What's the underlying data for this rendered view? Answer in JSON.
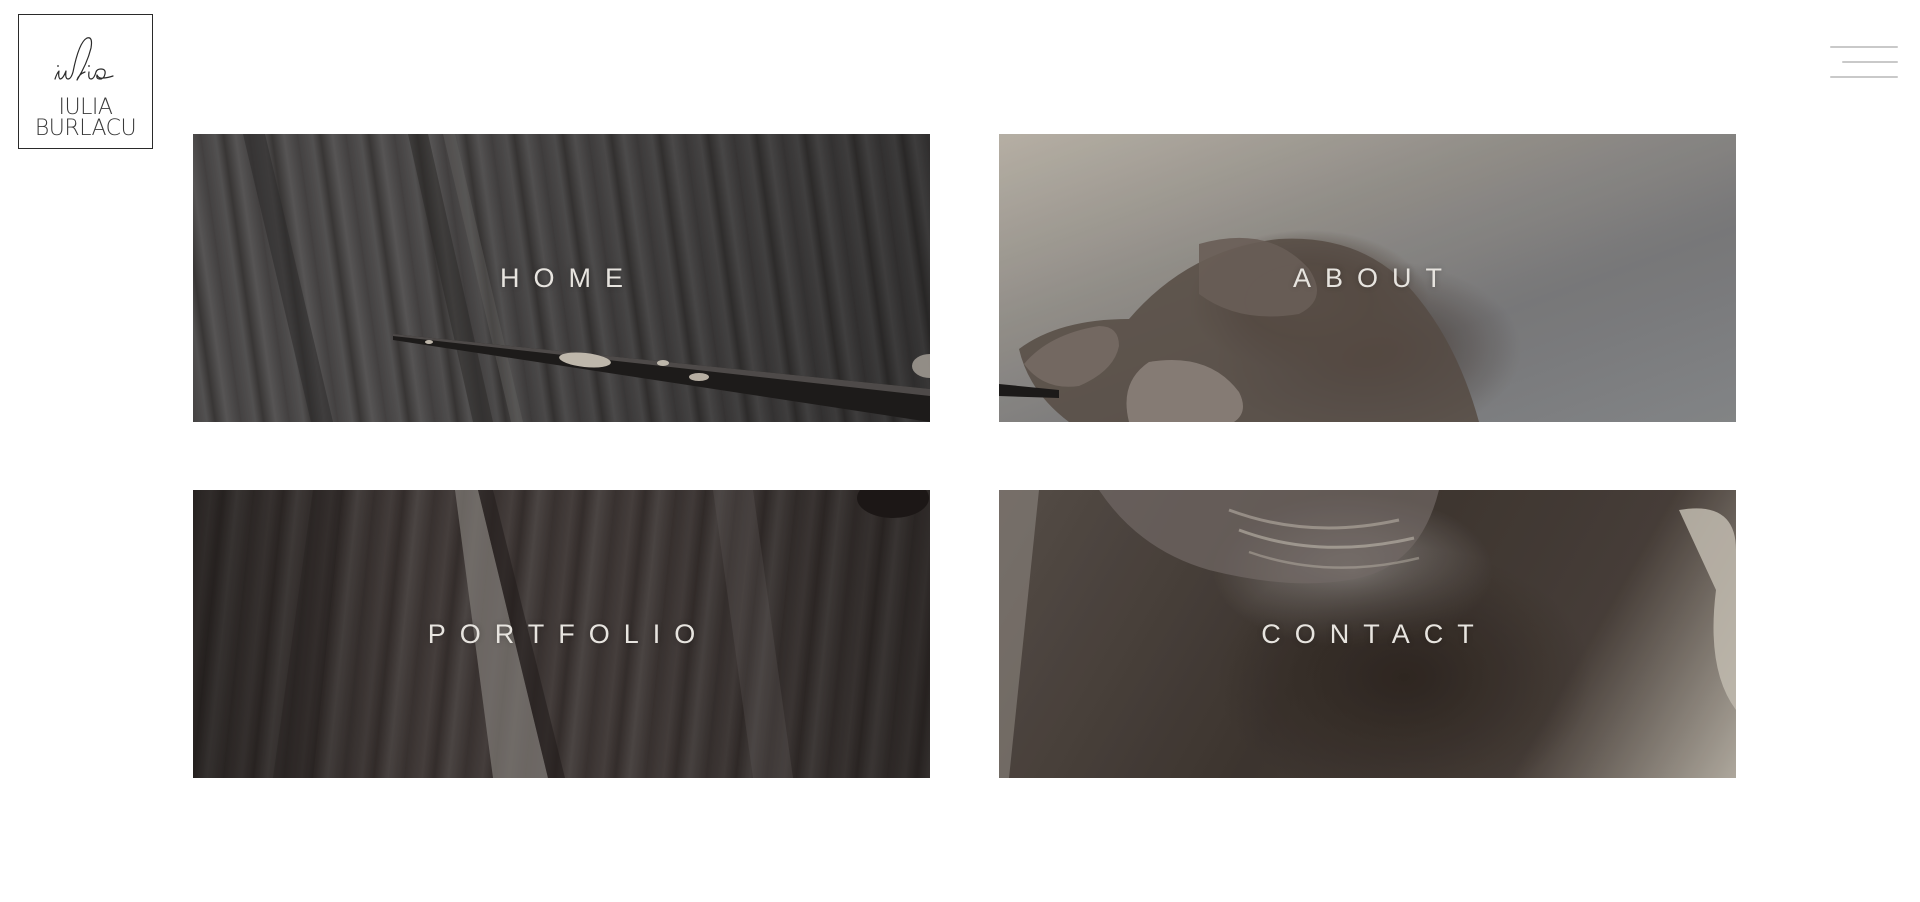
{
  "logo": {
    "script_text": "iulia",
    "name_line1": "IULIA",
    "name_line2": "BURLACU"
  },
  "menu": {
    "icon": "hamburger-menu-icon",
    "bar_color": "#c9c9c9"
  },
  "tiles": [
    {
      "label": "HOME"
    },
    {
      "label": "ABOUT"
    },
    {
      "label": "PORTFOLIO"
    },
    {
      "label": "CONTACT"
    }
  ],
  "colors": {
    "background": "#ffffff",
    "tile_text": "#e7e4df",
    "logo_border": "#2a2a2a"
  }
}
